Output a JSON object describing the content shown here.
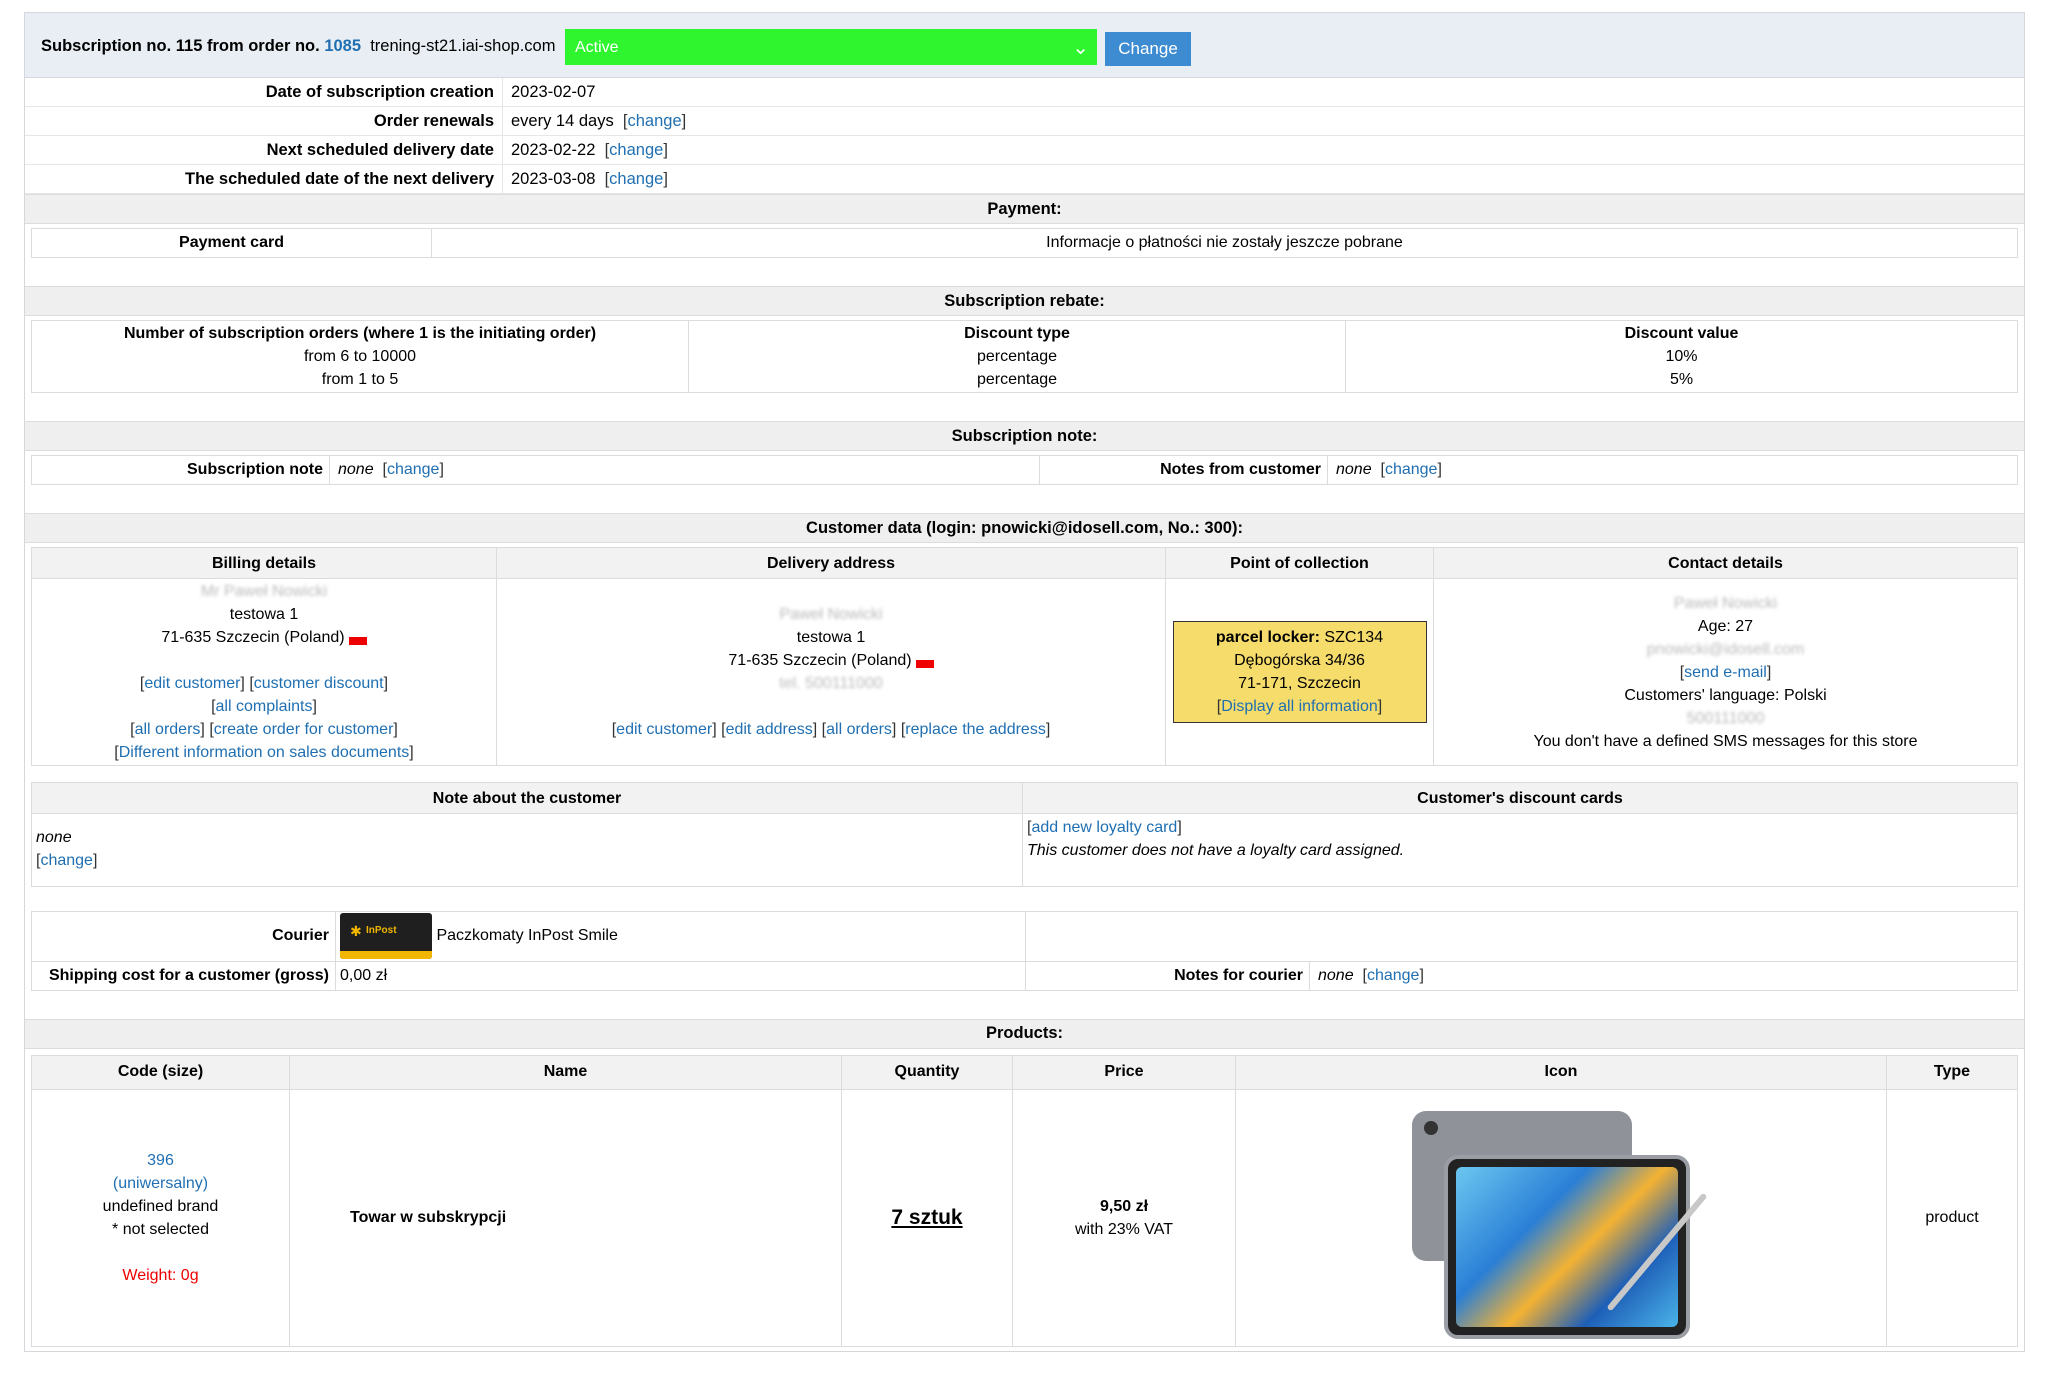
{
  "header": {
    "title_prefix": "Subscription no. 115 from order no.",
    "order_no": "1085",
    "shop": "trening-st21.iai-shop.com",
    "status": "Active",
    "status_color": "#2ef52e",
    "change_button": "Change"
  },
  "details": [
    {
      "label": "Date of subscription creation",
      "value": "2023-02-07",
      "link": ""
    },
    {
      "label": "Order renewals",
      "value": "every 14 days",
      "link": "change"
    },
    {
      "label": "Next scheduled delivery date",
      "value": "2023-02-22",
      "link": "change"
    },
    {
      "label": "The scheduled date of the next delivery",
      "value": "2023-03-08",
      "link": "change"
    }
  ],
  "payment": {
    "heading": "Payment:",
    "label": "Payment card",
    "value": "Informacje o płatności nie zostały jeszcze pobrane"
  },
  "rebate": {
    "heading": "Subscription rebate:",
    "col1": "Number of subscription orders (where 1 is the initiating order)",
    "col2": "Discount type",
    "col3": "Discount value",
    "rows": [
      {
        "range": "from 6 to 10000",
        "type": "percentage",
        "value": "10%"
      },
      {
        "range": "from 1 to 5",
        "type": "percentage",
        "value": "5%"
      }
    ]
  },
  "note": {
    "heading": "Subscription note:",
    "sub_label": "Subscription note",
    "sub_value": "none",
    "cust_label": "Notes from customer",
    "cust_value": "none",
    "change": "change"
  },
  "customer": {
    "heading": "Customer data (login: pnowicki@idosell.com, No.: 300):",
    "billing_title": "Billing details",
    "delivery_title": "Delivery address",
    "point_title": "Point of collection",
    "contact_title": "Contact details",
    "billing": {
      "name": "Mr Paweł Nowicki",
      "street": "testowa 1",
      "city": "71-635 Szczecin (Poland)",
      "links": [
        "edit customer",
        "customer discount",
        "all complaints",
        "all orders",
        "create order for customer",
        "Different information on sales documents"
      ]
    },
    "delivery": {
      "name": "Paweł Nowicki",
      "street": "testowa 1",
      "city": "71-635 Szczecin (Poland)",
      "phone": "tel. 500111000",
      "links": [
        "edit customer",
        "edit address",
        "all orders",
        "replace the address"
      ]
    },
    "point": {
      "label": "parcel locker:",
      "code": "SZC134",
      "street": "Dębogórska 34/36",
      "city": "71-171, Szczecin",
      "link": "Display all information"
    },
    "contact": {
      "name": "Paweł Nowicki",
      "age": "Age: 27",
      "email": "pnowicki@idosell.com",
      "send": "send e-mail",
      "language": "Customers' language: Polski",
      "phone": "500111000",
      "sms": "You don't have a defined SMS messages for this store"
    }
  },
  "about": {
    "note_title": "Note about the customer",
    "note_value": "none",
    "change": "change",
    "cards_title": "Customer's discount cards",
    "cards_link": "add new loyalty card",
    "cards_text": "This customer does not have a loyalty card assigned."
  },
  "courier": {
    "label": "Courier",
    "name": "Paczkomaty InPost Smile",
    "logo_text": "InPost",
    "cost_label": "Shipping cost for a customer (gross)",
    "cost_value": "0,00 zł",
    "notes_label": "Notes for courier",
    "notes_value": "none",
    "change": "change"
  },
  "products": {
    "heading": "Products:",
    "cols": [
      "Code (size)",
      "Name",
      "Quantity",
      "Price",
      "Icon",
      "Type"
    ],
    "row": {
      "code": "396",
      "size": "(uniwersalny)",
      "brand": "undefined brand",
      "selected": "* not selected",
      "weight": "Weight: 0g",
      "name": "Towar w subskrypcji",
      "quantity": "7 sztuk",
      "price": "9,50 zł",
      "vat": "with 23% VAT",
      "type": "product"
    }
  }
}
